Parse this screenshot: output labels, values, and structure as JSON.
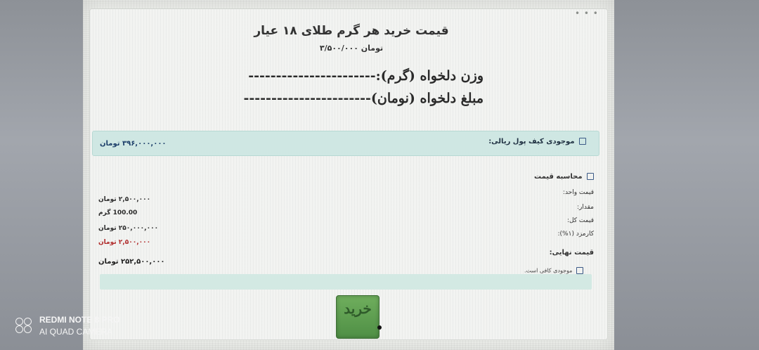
{
  "header": {
    "title": "قیمت خرید هر گرم طلای ۱۸ عیار",
    "subtitle": "تومان ۳/۵۰۰/۰۰۰",
    "close_icon": "dots-icon"
  },
  "handwritten": {
    "weight_label": "وزن دلخواه (گرم):-----------------------",
    "amount_label": "مبلغ دلخواه (نومان)-----------------------"
  },
  "wallet": {
    "label": "موجودی کیف پول ریالی:",
    "value": "۳۹۶,۰۰۰,۰۰۰ تومان"
  },
  "calculation": {
    "heading": "محاسبه قیمت",
    "rows": [
      {
        "label": "قیمت واحد:",
        "value": "۲,۵۰۰,۰۰۰ تومان"
      },
      {
        "label": "مقدار:",
        "value": "100.00 گرم"
      },
      {
        "label": "قیمت کل:",
        "value": "۲۵۰,۰۰۰,۰۰۰ تومان"
      },
      {
        "label": "کارمزد (۱%):",
        "value": "۲,۵۰۰,۰۰۰ تومان"
      }
    ],
    "final_label": "قیمت نهایی:",
    "final_value": "۲۵۲,۵۰۰,۰۰۰ تومان"
  },
  "status": {
    "text": "موجودی کافی است."
  },
  "buy_button": {
    "label": "خرید"
  },
  "watermark": {
    "line1": "REDMI NOTE 8 PRO",
    "line2": "AI QUAD CAMERA"
  }
}
